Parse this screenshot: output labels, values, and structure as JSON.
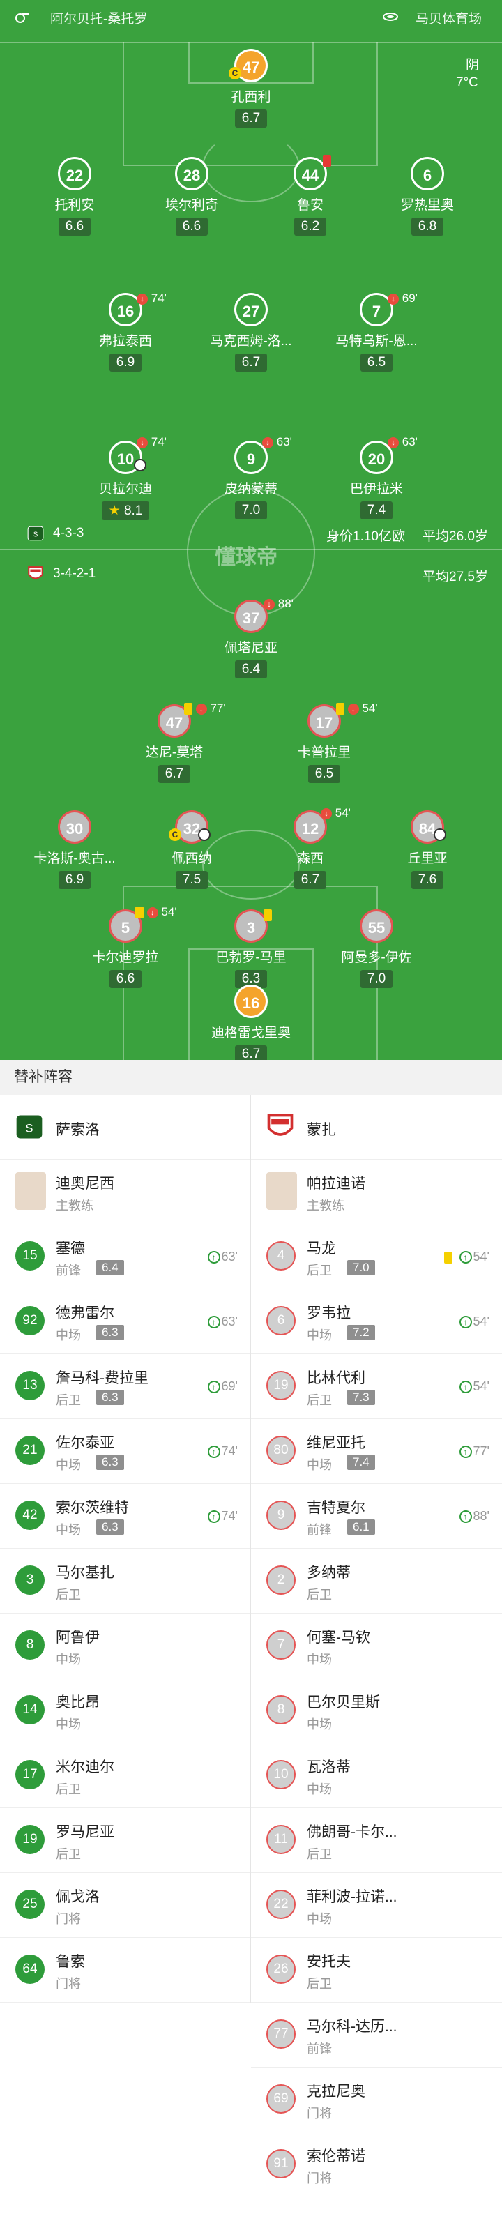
{
  "header": {
    "home_team": "阿尔贝托-桑托罗",
    "venue": "马贝体育场"
  },
  "weather": {
    "condition": "阴",
    "temp": "7°C"
  },
  "watermark": "懂球帝",
  "home": {
    "formation": "4-3-3",
    "value": "身价1.10亿欧",
    "avg_age": "平均26.0岁",
    "players": [
      {
        "num": "47",
        "name": "孔西利",
        "rating": "6.7"
      },
      {
        "num": "22",
        "name": "托利安",
        "rating": "6.6"
      },
      {
        "num": "28",
        "name": "埃尔利奇",
        "rating": "6.6"
      },
      {
        "num": "44",
        "name": "鲁安",
        "rating": "6.2"
      },
      {
        "num": "6",
        "name": "罗热里奥",
        "rating": "6.8"
      },
      {
        "num": "16",
        "name": "弗拉泰西",
        "rating": "6.9",
        "event": "74'"
      },
      {
        "num": "27",
        "name": "马克西姆-洛...",
        "rating": "6.7"
      },
      {
        "num": "7",
        "name": "马特乌斯-恩...",
        "rating": "6.5",
        "event": "69'"
      },
      {
        "num": "10",
        "name": "贝拉尔迪",
        "rating": "8.1",
        "event": "74'"
      },
      {
        "num": "9",
        "name": "皮纳蒙蒂",
        "rating": "7.0",
        "event": "63'"
      },
      {
        "num": "20",
        "name": "巴伊拉米",
        "rating": "7.4",
        "event": "63'"
      }
    ]
  },
  "away": {
    "formation": "3-4-2-1",
    "avg_age": "平均27.5岁",
    "players": [
      {
        "num": "37",
        "name": "佩塔尼亚",
        "rating": "6.4",
        "event": "88'"
      },
      {
        "num": "47",
        "name": "达尼-莫塔",
        "rating": "6.7",
        "event": "77'"
      },
      {
        "num": "17",
        "name": "卡普拉里",
        "rating": "6.5",
        "event": "54'"
      },
      {
        "num": "30",
        "name": "卡洛斯-奥古...",
        "rating": "6.9"
      },
      {
        "num": "32",
        "name": "佩西纳",
        "rating": "7.5"
      },
      {
        "num": "12",
        "name": "森西",
        "rating": "6.7",
        "event": "54'"
      },
      {
        "num": "84",
        "name": "丘里亚",
        "rating": "7.6"
      },
      {
        "num": "5",
        "name": "卡尔迪罗拉",
        "rating": "6.6",
        "event": "54'"
      },
      {
        "num": "3",
        "name": "巴勃罗-马里",
        "rating": "6.3"
      },
      {
        "num": "55",
        "name": "阿曼多-伊佐",
        "rating": "7.0"
      },
      {
        "num": "16",
        "name": "迪格雷戈里奥",
        "rating": "6.7"
      }
    ]
  },
  "subs_title": "替补阵容",
  "left_team": "萨索洛",
  "right_team": "蒙扎",
  "left_coach": {
    "name": "迪奥尼西",
    "role": "主教练"
  },
  "right_coach": {
    "name": "帕拉迪诺",
    "role": "主教练"
  },
  "left_subs": [
    {
      "num": "15",
      "name": "塞德",
      "pos": "前锋",
      "rating": "6.4",
      "time": "63'"
    },
    {
      "num": "92",
      "name": "德弗雷尔",
      "pos": "中场",
      "rating": "6.3",
      "time": "63'"
    },
    {
      "num": "13",
      "name": "詹马科-费拉里",
      "pos": "后卫",
      "rating": "6.3",
      "time": "69'"
    },
    {
      "num": "21",
      "name": "佐尔泰亚",
      "pos": "中场",
      "rating": "6.3",
      "time": "74'"
    },
    {
      "num": "42",
      "name": "索尔茨维特",
      "pos": "中场",
      "rating": "6.3",
      "time": "74'"
    },
    {
      "num": "3",
      "name": "马尔基扎",
      "pos": "后卫"
    },
    {
      "num": "8",
      "name": "阿鲁伊",
      "pos": "中场"
    },
    {
      "num": "14",
      "name": "奥比昂",
      "pos": "中场"
    },
    {
      "num": "17",
      "name": "米尔迪尔",
      "pos": "后卫"
    },
    {
      "num": "19",
      "name": "罗马尼亚",
      "pos": "后卫"
    },
    {
      "num": "25",
      "name": "佩戈洛",
      "pos": "门将"
    },
    {
      "num": "64",
      "name": "鲁索",
      "pos": "门将"
    }
  ],
  "right_subs": [
    {
      "num": "4",
      "name": "马龙",
      "pos": "后卫",
      "rating": "7.0",
      "time": "54'",
      "card": "yellow"
    },
    {
      "num": "6",
      "name": "罗韦拉",
      "pos": "中场",
      "rating": "7.2",
      "time": "54'"
    },
    {
      "num": "19",
      "name": "比林代利",
      "pos": "后卫",
      "rating": "7.3",
      "time": "54'"
    },
    {
      "num": "80",
      "name": "维尼亚托",
      "pos": "中场",
      "rating": "7.4",
      "time": "77'"
    },
    {
      "num": "9",
      "name": "吉特夏尔",
      "pos": "前锋",
      "rating": "6.1",
      "time": "88'"
    },
    {
      "num": "2",
      "name": "多纳蒂",
      "pos": "后卫"
    },
    {
      "num": "7",
      "name": "何塞-马钦",
      "pos": "中场"
    },
    {
      "num": "8",
      "name": "巴尔贝里斯",
      "pos": "中场"
    },
    {
      "num": "10",
      "name": "瓦洛蒂",
      "pos": "中场"
    },
    {
      "num": "11",
      "name": "佛朗哥-卡尔...",
      "pos": "后卫"
    },
    {
      "num": "22",
      "name": "菲利波-拉诺...",
      "pos": "中场"
    },
    {
      "num": "26",
      "name": "安托夫",
      "pos": "后卫"
    },
    {
      "num": "77",
      "name": "马尔科-达历...",
      "pos": "前锋"
    },
    {
      "num": "69",
      "name": "克拉尼奥",
      "pos": "门将"
    },
    {
      "num": "91",
      "name": "索伦蒂诺",
      "pos": "门将"
    }
  ]
}
